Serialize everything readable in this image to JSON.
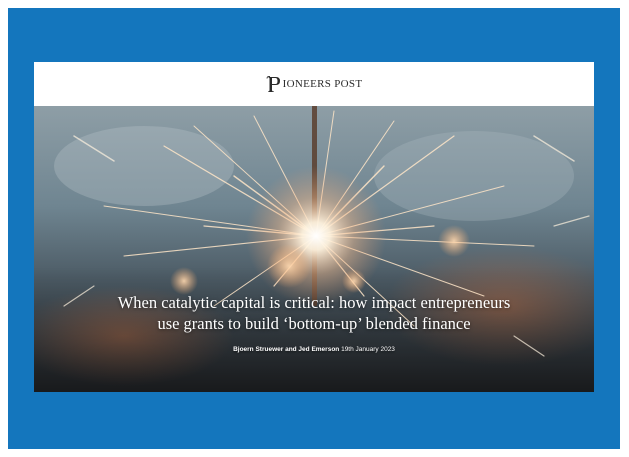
{
  "colors": {
    "frame": "#1476bd",
    "card": "#ffffff",
    "logo_text": "#2b2b2b",
    "headline": "#ffffff"
  },
  "header": {
    "logo_text": "IONEERS POST",
    "logo_icon": "pioneers-post-p-monogram"
  },
  "hero": {
    "image": "sparkler-photo",
    "headline_line1": "When catalytic capital is critical: how impact entrepreneurs",
    "headline_line2": "use grants to build ‘bottom-up’ blended finance",
    "byline_authors": "Bjoern Struewer and Jed Emerson",
    "byline_date": "19th January 2023"
  }
}
